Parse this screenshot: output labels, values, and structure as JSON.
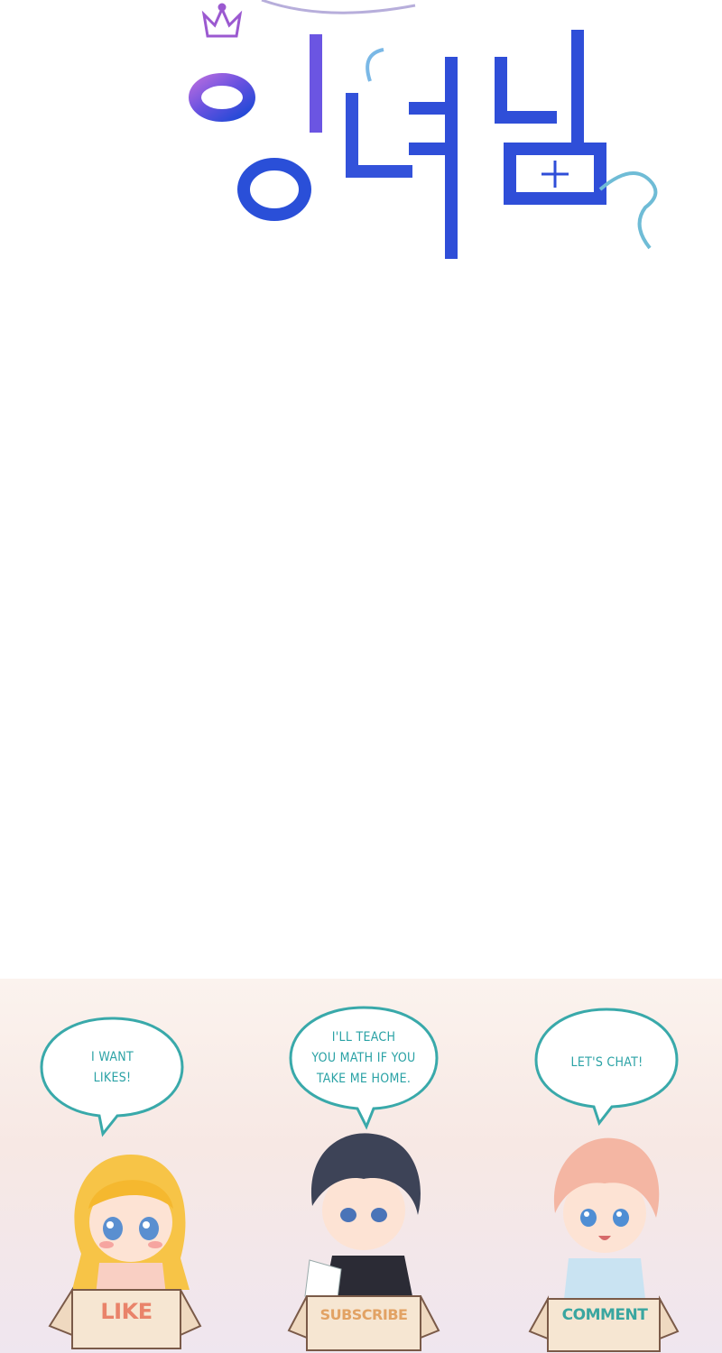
{
  "logo": {
    "text": "황녀님",
    "colors": {
      "purple": "#a25ad6",
      "blue": "#2f4ed8",
      "teal": "#6cc6d6"
    }
  },
  "promo": {
    "items": [
      {
        "bubble": [
          "I WANT",
          "LIKES!"
        ],
        "box_label": "LIKE",
        "label_color": "#e9836a"
      },
      {
        "bubble": [
          "I'LL TEACH",
          "YOU MATH IF YOU",
          "TAKE ME HOME."
        ],
        "box_label": "SUBSCRIBE",
        "label_color": "#e2a264"
      },
      {
        "bubble": [
          "LET'S CHAT!"
        ],
        "box_label": "COMMENT",
        "label_color": "#3aa6a0"
      }
    ]
  }
}
